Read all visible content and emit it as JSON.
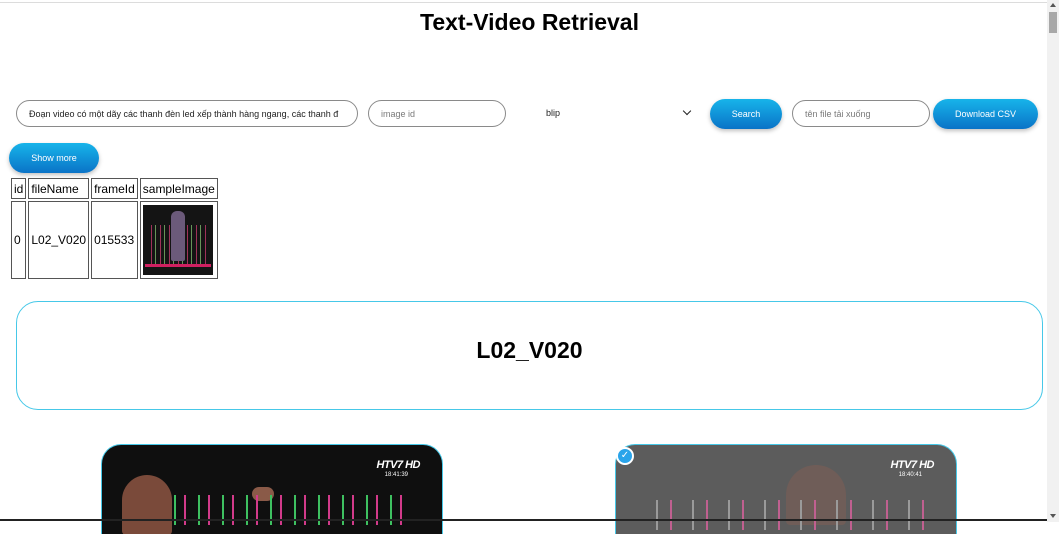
{
  "page": {
    "title": "Text-Video Retrieval"
  },
  "search": {
    "query_value": "Đoạn video có một dãy các thanh đèn led xếp thành hàng ngang, các thanh đ",
    "image_id_placeholder": "image id",
    "model_selected": "blip",
    "search_label": "Search",
    "filename_placeholder": "tên file tải xuống",
    "download_label": "Download CSV",
    "show_more_label": "Show more"
  },
  "table": {
    "headers": [
      "id",
      "fileName",
      "frameId",
      "sampleImage"
    ],
    "rows": [
      {
        "id": "0",
        "fileName": "L02_V020",
        "frameId": "015533"
      }
    ]
  },
  "video": {
    "title": "L02_V020",
    "frames": [
      {
        "logo": "HTV7 HD",
        "time": "18:41:39",
        "selected": false
      },
      {
        "logo": "HTV7 HD",
        "time": "18:40:41",
        "selected": true
      }
    ]
  },
  "colors": {
    "accent": "#0a73c7",
    "accent_light": "#17b4ea",
    "border_cyan": "#46c8e8"
  }
}
